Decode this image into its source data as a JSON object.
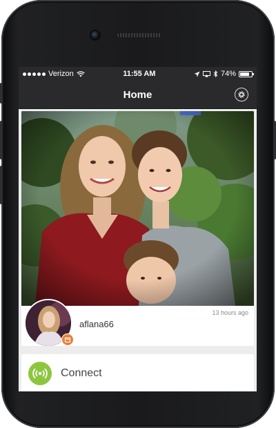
{
  "status_bar": {
    "carrier": "Verizon",
    "time": "11:55 AM",
    "battery_percent": "74%",
    "icons": [
      "signal-dots-icon",
      "wifi-icon",
      "location-arrow-icon",
      "airplay-icon",
      "bluetooth-icon",
      "battery-icon"
    ]
  },
  "nav": {
    "title": "Home",
    "settings_icon": "gear-icon"
  },
  "post": {
    "username": "aflana66",
    "timestamp": "13 hours ago",
    "avatar_badge_icon": "calendar-icon"
  },
  "connect": {
    "label": "Connect",
    "icon": "broadcast-signal-icon",
    "icon_color": "#8cc63e"
  },
  "colors": {
    "bar_bg": "#2a2a2c",
    "screen_bg": "#ededed",
    "badge": "#e8823a"
  }
}
